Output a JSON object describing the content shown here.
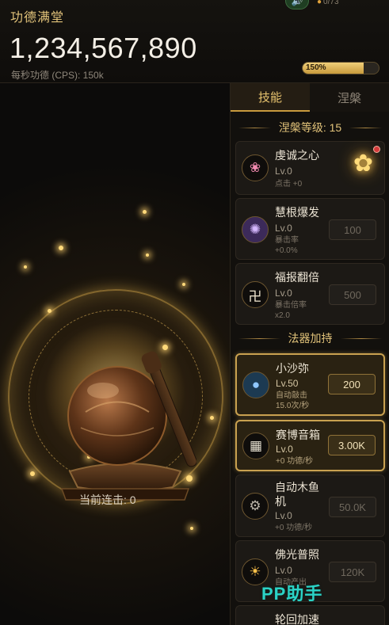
{
  "header": {
    "title": "功德满堂",
    "merit_total": "1,234,567,890",
    "cps_label": "每秒功德 (CPS): 150k",
    "stage_counter": "0/73",
    "boost_label": "150%",
    "boost_fill_fraction": 0.8
  },
  "stage": {
    "combo_label": "当前连击: 0"
  },
  "panel": {
    "tabs": [
      {
        "label": "技能",
        "active": true
      },
      {
        "label": "涅槃",
        "active": false
      }
    ],
    "nirvana_level": "涅槃等级: 15",
    "skills": [
      {
        "name": "虔诚之心",
        "level": "Lv.0",
        "desc1": "点击 +0",
        "desc2": "",
        "price": "",
        "icon": "lotus-icon"
      },
      {
        "name": "慧根爆发",
        "level": "Lv.0",
        "desc1": "暴击率",
        "desc2": "+0.0%",
        "price": "100",
        "icon": "brain-icon"
      },
      {
        "name": "福报翻倍",
        "level": "Lv.0",
        "desc1": "暴击倍率",
        "desc2": "x2.0",
        "price": "500",
        "icon": "swastika-icon"
      }
    ],
    "artifacts_heading": "法器加持",
    "artifacts": [
      {
        "name": "小沙弥",
        "level": "Lv.50",
        "desc1": "自动敲击",
        "desc2": "15.0次/秒",
        "price": "200",
        "icon": "monk-icon",
        "highlight": true
      },
      {
        "name": "赛博音箱",
        "level": "Lv.0",
        "desc1": "+0 功德/秒",
        "desc2": "",
        "price": "3.00K",
        "icon": "speaker-icon",
        "highlight": true
      },
      {
        "name": "自动木鱼",
        "name2": "机",
        "level": "Lv.0",
        "desc1": "+0 功德/秒",
        "desc2": "",
        "price": "50.0K",
        "icon": "gear-icon",
        "highlight": false
      },
      {
        "name": "佛光普照",
        "level": "Lv.0",
        "desc1": "自动产出",
        "desc2": "+0",
        "price": "120K",
        "icon": "sun-icon",
        "highlight": false
      },
      {
        "name": "轮回加速",
        "level": "",
        "desc1": "",
        "desc2": "",
        "price": "",
        "icon": "wheel-icon",
        "highlight": false
      }
    ]
  },
  "watermark": "PP助手",
  "colors": {
    "accent": "#e2c37a",
    "card_gold_border": "#c9a150",
    "watermark": "#2bd3c6"
  }
}
